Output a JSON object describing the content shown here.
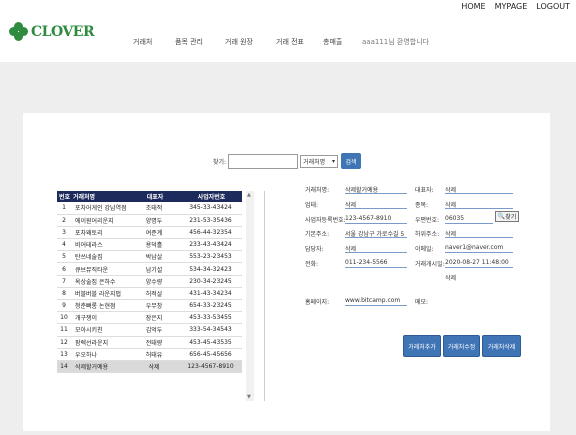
{
  "header": {
    "links": [
      "HOME",
      "MYPAGE",
      "LOGOUT"
    ],
    "logo_text": "CLOVER",
    "nav": [
      "거래처",
      "품목 관리",
      "거래 원장",
      "거래 전표",
      "총매출"
    ],
    "welcome": "aaa111님 환영합니다"
  },
  "search": {
    "label": "찾기:",
    "input_value": "",
    "select_value": "거래처명",
    "button": "검색"
  },
  "table": {
    "headers": [
      "번호",
      "거래처명",
      "대표자",
      "사업자번호"
    ],
    "rows": [
      [
        "1",
        "포차어게인 강남역점",
        "조태적",
        "345-33-43424"
      ],
      [
        "2",
        "에이원어리운지",
        "양명두",
        "231-53-35436"
      ],
      [
        "3",
        "포차왜토리",
        "여준계",
        "456-44-32354"
      ],
      [
        "4",
        "비어테라스",
        "용덕흘",
        "233-43-43424"
      ],
      [
        "5",
        "탄쓰네술집",
        "박남살",
        "553-23-23453"
      ],
      [
        "6",
        "큐브뮤직타운",
        "남기설",
        "534-34-32423"
      ],
      [
        "7",
        "옥상술집 은하수",
        "양수량",
        "230-34-23245"
      ],
      [
        "8",
        "버블버블 라운지펍",
        "허적살",
        "431-43-34234"
      ],
      [
        "9",
        "청춘뻐롱 논현점",
        "우무창",
        "654-33-23245"
      ],
      [
        "10",
        "개구쟁이",
        "장은지",
        "453-33-53455"
      ],
      [
        "11",
        "모아시키친",
        "김억두",
        "333-54-34543"
      ],
      [
        "12",
        "팜렉선라운지",
        "전태량",
        "453-45-43535"
      ],
      [
        "13",
        "우오하나",
        "허태유",
        "656-45-45656"
      ],
      [
        "14",
        "삭제할거예용",
        "삭제",
        "123-4567-8910"
      ]
    ]
  },
  "detail": {
    "company_label": "거래처명:",
    "company": "삭제할거예용",
    "ceo_label": "대표자:",
    "ceo": "삭제",
    "business_label": "업태:",
    "business": "삭제",
    "item_label": "종목:",
    "item": "삭제",
    "bizno_label": "사업자등록번호:",
    "bizno": "123-4567-8910",
    "zip_label": "우편번호:",
    "zip": "06035",
    "zip_button": "찾기",
    "addr_label": "기본주소:",
    "addr": "서울 강남구 가로수길 5",
    "addr2_label": "하위주소:",
    "addr2": "삭제",
    "manager_label": "담당자:",
    "manager": "삭제",
    "email_label": "이메일:",
    "email": "naver1@naver.com",
    "phone_label": "전화:",
    "phone": "011-234-5566",
    "start_label": "거래개시일:",
    "start": "2020-08-27 11:48:00",
    "start_extra": "삭제",
    "homepage_label": "홈페이지:",
    "homepage": "www.bitcamp.com",
    "memo_label": "메모:",
    "memo": ""
  },
  "actions": [
    "거래처추가",
    "거래처수정",
    "거래처삭제"
  ],
  "colors": {
    "brand": "#2e8b3f",
    "button": "#3f75b5",
    "table_header": "#1c2a5c"
  }
}
